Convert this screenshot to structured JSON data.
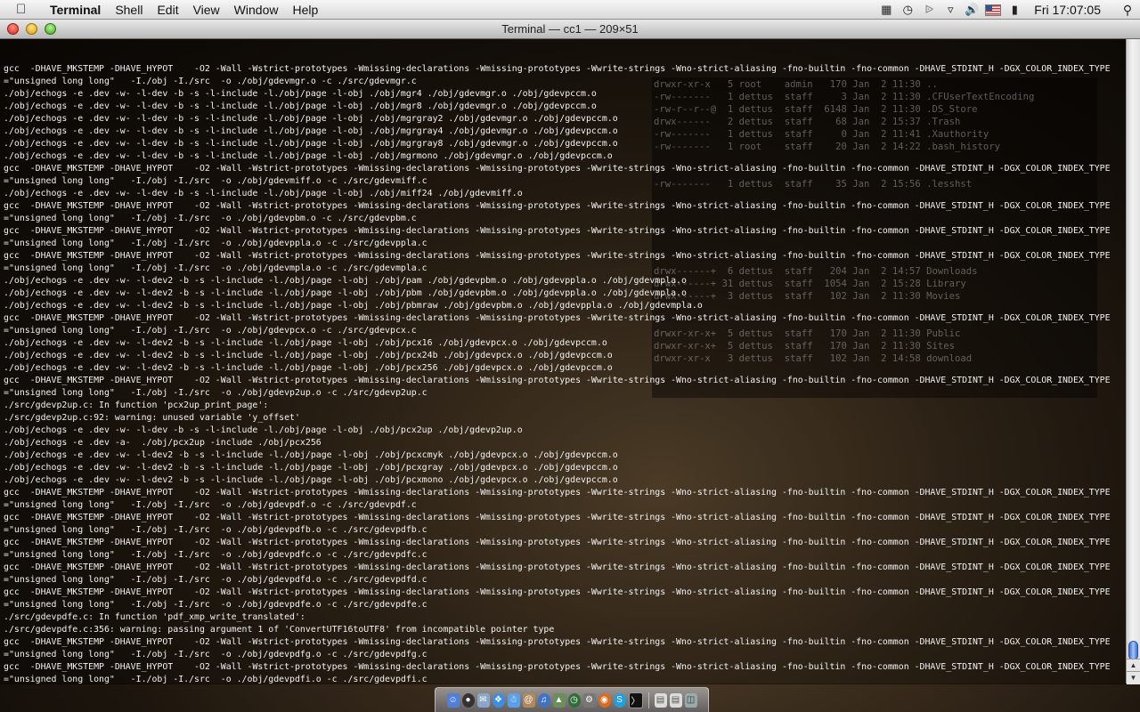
{
  "menubar": {
    "app_name": "Terminal",
    "items": [
      "Shell",
      "Edit",
      "View",
      "Window",
      "Help"
    ],
    "clock": "Fri 17:07:05"
  },
  "window": {
    "title": "Terminal — cc1 — 209×51"
  },
  "terminal": {
    "lines": [
      "gcc  -DHAVE_MKSTEMP -DHAVE_HYPOT    -O2 -Wall -Wstrict-prototypes -Wmissing-declarations -Wmissing-prototypes -Wwrite-strings -Wno-strict-aliasing -fno-builtin -fno-common -DHAVE_STDINT_H -DGX_COLOR_INDEX_TYPE",
      "=\"unsigned long long\"   -I./obj -I./src  -o ./obj/gdevmgr.o -c ./src/gdevmgr.c",
      "./obj/echogs -e .dev -w- -l-dev -b -s -l-include -l./obj/page -l-obj ./obj/mgr4 ./obj/gdevmgr.o ./obj/gdevpccm.o",
      "./obj/echogs -e .dev -w- -l-dev -b -s -l-include -l./obj/page -l-obj ./obj/mgr8 ./obj/gdevmgr.o ./obj/gdevpccm.o",
      "./obj/echogs -e .dev -w- -l-dev -b -s -l-include -l./obj/page -l-obj ./obj/mgrgray2 ./obj/gdevmgr.o ./obj/gdevpccm.o",
      "./obj/echogs -e .dev -w- -l-dev -b -s -l-include -l./obj/page -l-obj ./obj/mgrgray4 ./obj/gdevmgr.o ./obj/gdevpccm.o",
      "./obj/echogs -e .dev -w- -l-dev -b -s -l-include -l./obj/page -l-obj ./obj/mgrgray8 ./obj/gdevmgr.o ./obj/gdevpccm.o",
      "./obj/echogs -e .dev -w- -l-dev -b -s -l-include -l./obj/page -l-obj ./obj/mgrmono ./obj/gdevmgr.o ./obj/gdevpccm.o",
      "gcc  -DHAVE_MKSTEMP -DHAVE_HYPOT    -O2 -Wall -Wstrict-prototypes -Wmissing-declarations -Wmissing-prototypes -Wwrite-strings -Wno-strict-aliasing -fno-builtin -fno-common -DHAVE_STDINT_H -DGX_COLOR_INDEX_TYPE",
      "=\"unsigned long long\"   -I./obj -I./src  -o ./obj/gdevmiff.o -c ./src/gdevmiff.c",
      "./obj/echogs -e .dev -w- -l-dev -b -s -l-include -l./obj/page -l-obj ./obj/miff24 ./obj/gdevmiff.o",
      "gcc  -DHAVE_MKSTEMP -DHAVE_HYPOT    -O2 -Wall -Wstrict-prototypes -Wmissing-declarations -Wmissing-prototypes -Wwrite-strings -Wno-strict-aliasing -fno-builtin -fno-common -DHAVE_STDINT_H -DGX_COLOR_INDEX_TYPE",
      "=\"unsigned long long\"   -I./obj -I./src  -o ./obj/gdevpbm.o -c ./src/gdevpbm.c",
      "gcc  -DHAVE_MKSTEMP -DHAVE_HYPOT    -O2 -Wall -Wstrict-prototypes -Wmissing-declarations -Wmissing-prototypes -Wwrite-strings -Wno-strict-aliasing -fno-builtin -fno-common -DHAVE_STDINT_H -DGX_COLOR_INDEX_TYPE",
      "=\"unsigned long long\"   -I./obj -I./src  -o ./obj/gdevppla.o -c ./src/gdevppla.c",
      "gcc  -DHAVE_MKSTEMP -DHAVE_HYPOT    -O2 -Wall -Wstrict-prototypes -Wmissing-declarations -Wmissing-prototypes -Wwrite-strings -Wno-strict-aliasing -fno-builtin -fno-common -DHAVE_STDINT_H -DGX_COLOR_INDEX_TYPE",
      "=\"unsigned long long\"   -I./obj -I./src  -o ./obj/gdevmpla.o -c ./src/gdevmpla.c",
      "./obj/echogs -e .dev -w- -l-dev2 -b -s -l-include -l./obj/page -l-obj ./obj/pam ./obj/gdevpbm.o ./obj/gdevppla.o ./obj/gdevmpla.o",
      "./obj/echogs -e .dev -w- -l-dev2 -b -s -l-include -l./obj/page -l-obj ./obj/pbm ./obj/gdevpbm.o ./obj/gdevppla.o ./obj/gdevmpla.o",
      "./obj/echogs -e .dev -w- -l-dev2 -b -s -l-include -l./obj/page -l-obj ./obj/pbmraw ./obj/gdevpbm.o ./obj/gdevppla.o ./obj/gdevmpla.o",
      "gcc  -DHAVE_MKSTEMP -DHAVE_HYPOT    -O2 -Wall -Wstrict-prototypes -Wmissing-declarations -Wmissing-prototypes -Wwrite-strings -Wno-strict-aliasing -fno-builtin -fno-common -DHAVE_STDINT_H -DGX_COLOR_INDEX_TYPE",
      "=\"unsigned long long\"   -I./obj -I./src  -o ./obj/gdevpcx.o -c ./src/gdevpcx.c",
      "./obj/echogs -e .dev -w- -l-dev2 -b -s -l-include -l./obj/page -l-obj ./obj/pcx16 ./obj/gdevpcx.o ./obj/gdevpccm.o",
      "./obj/echogs -e .dev -w- -l-dev2 -b -s -l-include -l./obj/page -l-obj ./obj/pcx24b ./obj/gdevpcx.o ./obj/gdevpccm.o",
      "./obj/echogs -e .dev -w- -l-dev2 -b -s -l-include -l./obj/page -l-obj ./obj/pcx256 ./obj/gdevpcx.o ./obj/gdevpccm.o",
      "gcc  -DHAVE_MKSTEMP -DHAVE_HYPOT    -O2 -Wall -Wstrict-prototypes -Wmissing-declarations -Wmissing-prototypes -Wwrite-strings -Wno-strict-aliasing -fno-builtin -fno-common -DHAVE_STDINT_H -DGX_COLOR_INDEX_TYPE",
      "=\"unsigned long long\"   -I./obj -I./src  -o ./obj/gdevp2up.o -c ./src/gdevp2up.c",
      "./src/gdevp2up.c: In function 'pcx2up_print_page':",
      "./src/gdevp2up.c:92: warning: unused variable 'y_offset'",
      "./obj/echogs -e .dev -w- -l-dev -b -s -l-include -l./obj/page -l-obj ./obj/pcx2up ./obj/gdevp2up.o",
      "./obj/echogs -e .dev -a-  ./obj/pcx2up -include ./obj/pcx256",
      "./obj/echogs -e .dev -w- -l-dev2 -b -s -l-include -l./obj/page -l-obj ./obj/pcxcmyk ./obj/gdevpcx.o ./obj/gdevpccm.o",
      "./obj/echogs -e .dev -w- -l-dev2 -b -s -l-include -l./obj/page -l-obj ./obj/pcxgray ./obj/gdevpcx.o ./obj/gdevpccm.o",
      "./obj/echogs -e .dev -w- -l-dev2 -b -s -l-include -l./obj/page -l-obj ./obj/pcxmono ./obj/gdevpcx.o ./obj/gdevpccm.o",
      "gcc  -DHAVE_MKSTEMP -DHAVE_HYPOT    -O2 -Wall -Wstrict-prototypes -Wmissing-declarations -Wmissing-prototypes -Wwrite-strings -Wno-strict-aliasing -fno-builtin -fno-common -DHAVE_STDINT_H -DGX_COLOR_INDEX_TYPE",
      "=\"unsigned long long\"   -I./obj -I./src  -o ./obj/gdevpdf.o -c ./src/gdevpdf.c",
      "gcc  -DHAVE_MKSTEMP -DHAVE_HYPOT    -O2 -Wall -Wstrict-prototypes -Wmissing-declarations -Wmissing-prototypes -Wwrite-strings -Wno-strict-aliasing -fno-builtin -fno-common -DHAVE_STDINT_H -DGX_COLOR_INDEX_TYPE",
      "=\"unsigned long long\"   -I./obj -I./src  -o ./obj/gdevpdfb.o -c ./src/gdevpdfb.c",
      "gcc  -DHAVE_MKSTEMP -DHAVE_HYPOT    -O2 -Wall -Wstrict-prototypes -Wmissing-declarations -Wmissing-prototypes -Wwrite-strings -Wno-strict-aliasing -fno-builtin -fno-common -DHAVE_STDINT_H -DGX_COLOR_INDEX_TYPE",
      "=\"unsigned long long\"   -I./obj -I./src  -o ./obj/gdevpdfc.o -c ./src/gdevpdfc.c",
      "gcc  -DHAVE_MKSTEMP -DHAVE_HYPOT    -O2 -Wall -Wstrict-prototypes -Wmissing-declarations -Wmissing-prototypes -Wwrite-strings -Wno-strict-aliasing -fno-builtin -fno-common -DHAVE_STDINT_H -DGX_COLOR_INDEX_TYPE",
      "=\"unsigned long long\"   -I./obj -I./src  -o ./obj/gdevpdfd.o -c ./src/gdevpdfd.c",
      "gcc  -DHAVE_MKSTEMP -DHAVE_HYPOT    -O2 -Wall -Wstrict-prototypes -Wmissing-declarations -Wmissing-prototypes -Wwrite-strings -Wno-strict-aliasing -fno-builtin -fno-common -DHAVE_STDINT_H -DGX_COLOR_INDEX_TYPE",
      "=\"unsigned long long\"   -I./obj -I./src  -o ./obj/gdevpdfe.o -c ./src/gdevpdfe.c",
      "./src/gdevpdfe.c: In function 'pdf_xmp_write_translated':",
      "./src/gdevpdfe.c:356: warning: passing argument 1 of 'ConvertUTF16toUTF8' from incompatible pointer type",
      "gcc  -DHAVE_MKSTEMP -DHAVE_HYPOT    -O2 -Wall -Wstrict-prototypes -Wmissing-declarations -Wmissing-prototypes -Wwrite-strings -Wno-strict-aliasing -fno-builtin -fno-common -DHAVE_STDINT_H -DGX_COLOR_INDEX_TYPE",
      "=\"unsigned long long\"   -I./obj -I./src  -o ./obj/gdevpdfg.o -c ./src/gdevpdfg.c",
      "gcc  -DHAVE_MKSTEMP -DHAVE_HYPOT    -O2 -Wall -Wstrict-prototypes -Wmissing-declarations -Wmissing-prototypes -Wwrite-strings -Wno-strict-aliasing -fno-builtin -fno-common -DHAVE_STDINT_H -DGX_COLOR_INDEX_TYPE",
      "=\"unsigned long long\"   -I./obj -I./src  -o ./obj/gdevpdfi.o -c ./src/gdevpdfi.c"
    ],
    "background_listing": [
      "drwxr-xr-x   5 root    admin   170 Jan  2 11:30 ..",
      "-rw-------   1 dettus  staff     3 Jan  2 11:30 .CFUserTextEncoding",
      "-rw-r--r--@  1 dettus  staff  6148 Jan  2 11:30 .DS_Store",
      "drwx------   2 dettus  staff    68 Jan  2 15:37 .Trash",
      "-rw-------   1 dettus  staff     0 Jan  2 11:41 .Xauthority",
      "-rw-------   1 root    staff    20 Jan  2 14:22 .bash_history",
      "",
      "",
      "-rw-------   1 dettus  staff    35 Jan  2 15:56 .lesshst",
      "",
      "",
      "",
      "",
      "",
      "",
      "drwx------+  6 dettus  staff   204 Jan  2 14:57 Downloads",
      "drwx------+ 31 dettus  staff  1054 Jan  2 15:28 Library",
      "drwx------+  3 dettus  staff   102 Jan  2 11:30 Movies",
      "",
      "",
      "drwxr-xr-x+  5 dettus  staff   170 Jan  2 11:30 Public",
      "drwxr-xr-x+  5 dettus  staff   170 Jan  2 11:30 Sites",
      "drwxr-xr-x   3 dettus  staff   102 Jan  2 14:58 download"
    ]
  },
  "icons": {
    "apple": "apple-logo-icon",
    "status": [
      "script-menu-icon",
      "time-machine-icon",
      "bluetooth-icon",
      "wifi-icon",
      "volume-icon",
      "us-flag-input-icon",
      "battery-icon",
      "spotlight-icon"
    ]
  },
  "colors": {
    "terminal_text": "#f2f2f2",
    "scroll_thumb": "#3b6fd1"
  }
}
